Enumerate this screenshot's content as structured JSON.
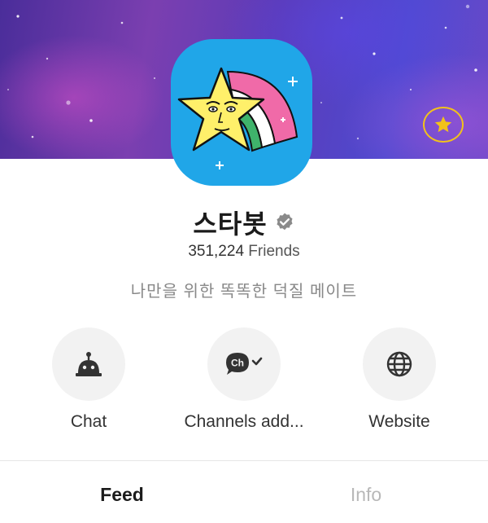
{
  "profile": {
    "name": "스타봇",
    "friends_count": "351,224",
    "friends_label": "Friends",
    "description": "나만을 위한 똑똑한 덕질 메이트",
    "avatar_icon": "star-character-icon",
    "verified_icon": "verified-badge-icon"
  },
  "header": {
    "favorite_icon": "star-icon",
    "accent_color": "#f2c21a"
  },
  "actions": [
    {
      "label": "Chat",
      "icon": "bot-icon"
    },
    {
      "label": "Channels add...",
      "icon": "channel-add-icon",
      "icon_text": "Ch"
    },
    {
      "label": "Website",
      "icon": "globe-icon"
    }
  ],
  "tabs": [
    {
      "label": "Feed",
      "active": true
    },
    {
      "label": "Info",
      "active": false
    }
  ]
}
